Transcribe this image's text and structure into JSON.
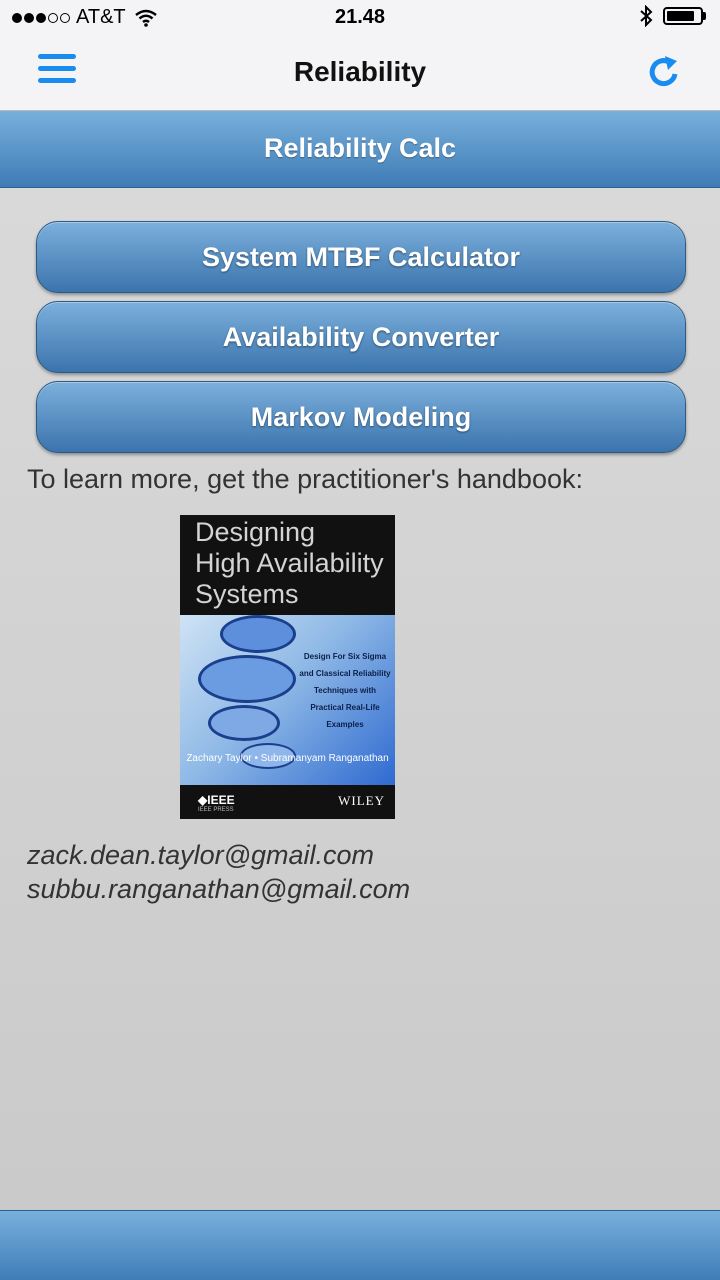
{
  "status_bar": {
    "carrier": "AT&T",
    "time": "21.48",
    "signal_bars_filled": 3,
    "signal_bars_total": 5
  },
  "nav": {
    "title": "Reliability",
    "menu_icon": "hamburger-menu-icon",
    "refresh_icon": "refresh-icon",
    "accent_color": "#1a8cf0"
  },
  "header": {
    "title": "Reliability Calc"
  },
  "buttons": [
    {
      "label": "System MTBF Calculator"
    },
    {
      "label": "Availability Converter"
    },
    {
      "label": "Markov Modeling"
    }
  ],
  "content": {
    "intro": "To learn more, get the practitioner's handbook:",
    "book": {
      "title_lines": [
        "Designing",
        "High Availability",
        "Systems"
      ],
      "tagline": "Design For Six Sigma and Classical Reliability Techniques with Practical Real-Life Examples",
      "authors": "Zachary Taylor • Subramanyam Ranganathan",
      "publisher": "IEEE",
      "press": "IEEE PRESS",
      "brand": "WILEY"
    },
    "emails": [
      "zack.dean.taylor@gmail.com",
      "subbu.ranganathan@gmail.com"
    ]
  },
  "colors": {
    "header_gradient_top": "#78b0dc",
    "header_gradient_bottom": "#3f7cb6",
    "background": "#d4d4d4"
  }
}
